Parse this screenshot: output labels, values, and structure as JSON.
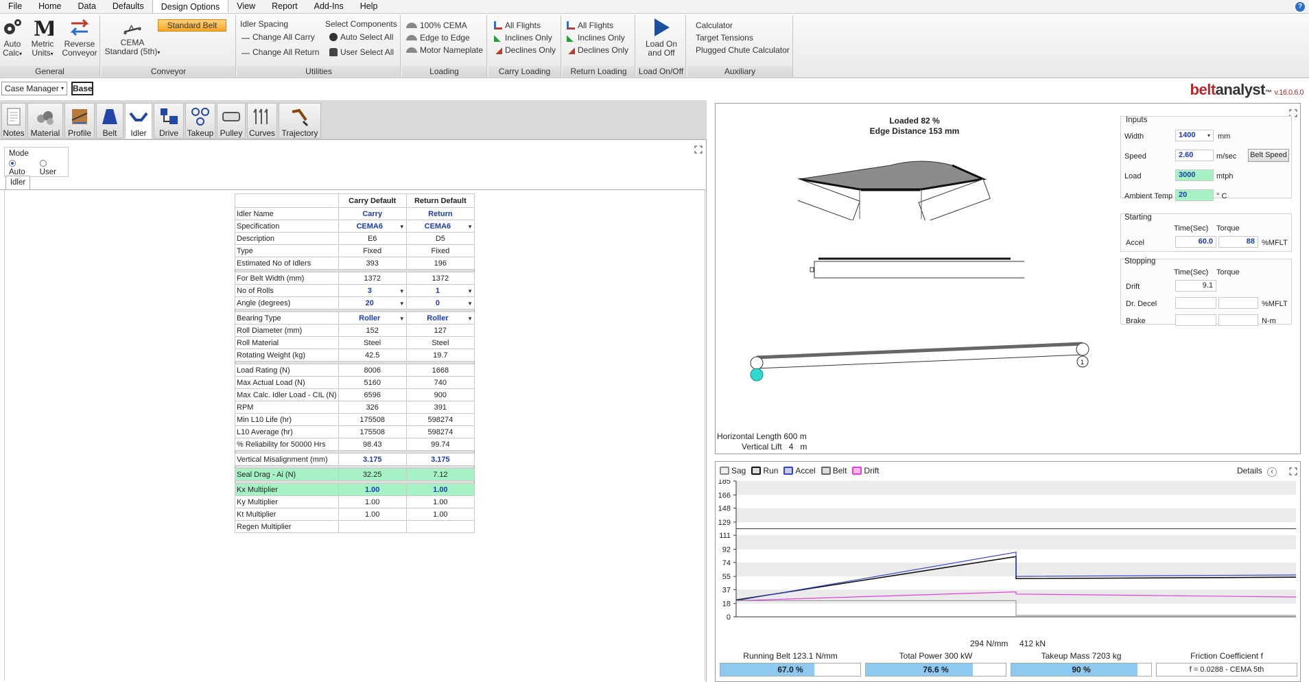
{
  "menu": [
    "File",
    "Home",
    "Data",
    "Defaults",
    "Design Options",
    "View",
    "Report",
    "Add-Ins",
    "Help"
  ],
  "ribbon": {
    "general": {
      "label": "General",
      "auto": "Auto",
      "calc": "Calc",
      "metric": "Metric",
      "units": "Units",
      "reverse": "Reverse",
      "conveyor": "Conveyor"
    },
    "conveyor": {
      "label": "Conveyor",
      "cema": "CEMA",
      "standard": "Standard (5th)",
      "standard_belt": "Standard Belt"
    },
    "utilities": {
      "label": "Utilities",
      "idler_spacing": "Idler Spacing",
      "change_all_carry": "Change All Carry",
      "change_all_return": "Change All Return",
      "select_components": "Select Components",
      "auto_select_all": "Auto Select All",
      "user_select_all": "User Select All"
    },
    "loading": {
      "label": "Loading",
      "cema100": "100% CEMA",
      "edge_to_edge": "Edge to Edge",
      "motor_nameplate": "Motor Nameplate"
    },
    "carry_loading": {
      "label": "Carry Loading",
      "all_flights": "All Flights",
      "inclines_only": "Inclines Only",
      "declines_only": "Declines Only"
    },
    "return_loading": {
      "label": "Return Loading",
      "all_flights": "All Flights",
      "inclines_only": "Inclines Only",
      "declines_only": "Declines Only"
    },
    "load_onoff": {
      "label": "Load On/Off",
      "line1": "Load On",
      "line2": "and Off"
    },
    "auxiliary": {
      "label": "Auxiliary",
      "calculator": "Calculator",
      "target_tensions": "Target Tensions",
      "plugged_chute": "Plugged Chute Calculator"
    }
  },
  "case": {
    "manager": "Case Manager",
    "base": "Base"
  },
  "brand": {
    "part1": "belt",
    "part2": "analyst",
    "tm": "™",
    "version": "v.16.0.6.0"
  },
  "tools": [
    "Notes",
    "Material",
    "Profile",
    "Belt",
    "Idler",
    "Drive",
    "Takeup",
    "Pulley",
    "Curves",
    "Trajectory"
  ],
  "mode": {
    "title": "Mode",
    "auto": "Auto",
    "user": "User"
  },
  "idler_tab": "Idler",
  "table": {
    "headers": [
      "",
      "Carry Default",
      "Return Default"
    ],
    "rows": [
      {
        "label": "Idler Name",
        "carry": "Carry",
        "ret": "Return",
        "style": "blue"
      },
      {
        "label": "Specification",
        "carry": "CEMA6",
        "ret": "CEMA6",
        "style": "blue",
        "dd": true
      },
      {
        "label": "Description",
        "carry": "E6",
        "ret": "D5"
      },
      {
        "label": "Type",
        "carry": "Fixed",
        "ret": "Fixed"
      },
      {
        "label": "Estimated No of Idlers",
        "carry": "393",
        "ret": "196"
      },
      {
        "sep": true
      },
      {
        "label": "For Belt Width (mm)",
        "carry": "1372",
        "ret": "1372"
      },
      {
        "label": "No of Rolls",
        "carry": "3",
        "ret": "1",
        "style": "blue",
        "dd": true
      },
      {
        "label": "Angle (degrees)",
        "carry": "20",
        "ret": "0",
        "style": "blue",
        "dd": true
      },
      {
        "sep": true
      },
      {
        "label": "Bearing Type",
        "carry": "Roller",
        "ret": "Roller",
        "style": "blue",
        "dd": true
      },
      {
        "label": "Roll Diameter (mm)",
        "carry": "152",
        "ret": "127"
      },
      {
        "label": "Roll Material",
        "carry": "Steel",
        "ret": "Steel"
      },
      {
        "label": "Rotating Weight (kg)",
        "carry": "42.5",
        "ret": "19.7"
      },
      {
        "sep": true
      },
      {
        "label": "Load Rating (N)",
        "carry": "8006",
        "ret": "1668"
      },
      {
        "label": "Max Actual Load (N)",
        "carry": "5160",
        "ret": "740"
      },
      {
        "label": "Max Calc. Idler Load - CIL (N)",
        "carry": "6596",
        "ret": "900"
      },
      {
        "label": "RPM",
        "carry": "326",
        "ret": "391"
      },
      {
        "label": "Min L10 Life (hr)",
        "carry": "175508",
        "ret": "598274"
      },
      {
        "label": "L10 Average (hr)",
        "carry": "175508",
        "ret": "598274"
      },
      {
        "label": "% Reliability for 50000 Hrs",
        "carry": "98.43",
        "ret": "99.74"
      },
      {
        "sep": true
      },
      {
        "label": "Vertical Misalignment (mm)",
        "carry": "3.175",
        "ret": "3.175",
        "style": "bluenb"
      },
      {
        "sep": true
      },
      {
        "label": "Seal Drag - Ai (N)",
        "carry": "32.25",
        "ret": "7.12",
        "style": "green"
      },
      {
        "sep": true
      },
      {
        "label": "Kx Multiplier",
        "carry": "1.00",
        "ret": "1.00",
        "style": "greenblue"
      },
      {
        "label": "Ky Multiplier",
        "carry": "1.00",
        "ret": "1.00"
      },
      {
        "label": "Kt Multiplier",
        "carry": "1.00",
        "ret": "1.00"
      },
      {
        "label": "Regen Multiplier",
        "carry": "",
        "ret": ""
      }
    ]
  },
  "view": {
    "loaded": "Loaded 82 %",
    "edge_distance": "Edge Distance 153 mm",
    "horizontal_length": "Horizontal Length 600 m",
    "vertical_lift": "Vertical Lift   4   m"
  },
  "inputs": {
    "title": "Inputs",
    "width_label": "Width",
    "width_value": "1400",
    "width_unit": "mm",
    "speed_label": "Speed",
    "speed_value": "2.60",
    "speed_unit": "m/sec",
    "belt_speed_btn": "Belt Speed",
    "load_label": "Load",
    "load_value": "3000",
    "load_unit": "mtph",
    "ambient_label": "Ambient Temp",
    "ambient_value": "20",
    "ambient_unit": "° C"
  },
  "starting": {
    "title": "Starting",
    "time_hdr": "Time(Sec)",
    "torque_hdr": "Torque",
    "accel_label": "Accel",
    "accel_time": "60.0",
    "accel_torque": "88",
    "unit": "%MFLT"
  },
  "stopping": {
    "title": "Stopping",
    "time_hdr": "Time(Sec)",
    "torque_hdr": "Torque",
    "drift_label": "Drift",
    "drift_time": "9.1",
    "decel_label": "Dr. Decel",
    "decel_unit": "%MFLT",
    "brake_label": "Brake",
    "brake_unit": "N-m"
  },
  "legend": [
    "Sag",
    "Run",
    "Accel",
    "Belt",
    "Drift"
  ],
  "legend_colors": [
    "#888888",
    "#111111",
    "#3344cc",
    "#666666",
    "#e040e0"
  ],
  "details": "Details",
  "chart_data": {
    "type": "line",
    "y_ticks": [
      0,
      18,
      37,
      55,
      74,
      92,
      111,
      129,
      148,
      166,
      185
    ],
    "ylim": [
      0,
      185
    ],
    "xlim": [
      0,
      1
    ],
    "series": [
      {
        "name": "Run",
        "color": "#111111",
        "x": [
          0,
          0.5,
          0.5,
          1.0
        ],
        "y": [
          23,
          82,
          52,
          54
        ]
      },
      {
        "name": "Accel",
        "color": "#3344cc",
        "x": [
          0,
          0.5,
          0.5,
          1.0
        ],
        "y": [
          22,
          88,
          55,
          57
        ]
      },
      {
        "name": "Drift",
        "color": "#e040e0",
        "x": [
          0,
          0.5,
          0.5,
          1.0
        ],
        "y": [
          22,
          34,
          31,
          27
        ]
      },
      {
        "name": "Belt",
        "color": "#444444",
        "x": [
          0,
          1.0
        ],
        "y": [
          120,
          120
        ]
      },
      {
        "name": "Sag",
        "color": "#999999",
        "x": [
          0,
          0.5,
          0.5,
          1.0
        ],
        "y": [
          22,
          22,
          2,
          2
        ]
      }
    ],
    "footer": "294 N/mm     412 kN"
  },
  "stats": [
    {
      "title": "Running Belt 123.1 N/mm",
      "value": "67.0 %",
      "pct": 67
    },
    {
      "title": "Total Power 300 kW",
      "value": "76.6 %",
      "pct": 76.6
    },
    {
      "title": "Takeup Mass 7203 kg",
      "value": "90 %",
      "pct": 90
    },
    {
      "title": "Friction Coefficient f",
      "value": "f = 0.0288 - CEMA 5th",
      "pct": 0
    }
  ]
}
